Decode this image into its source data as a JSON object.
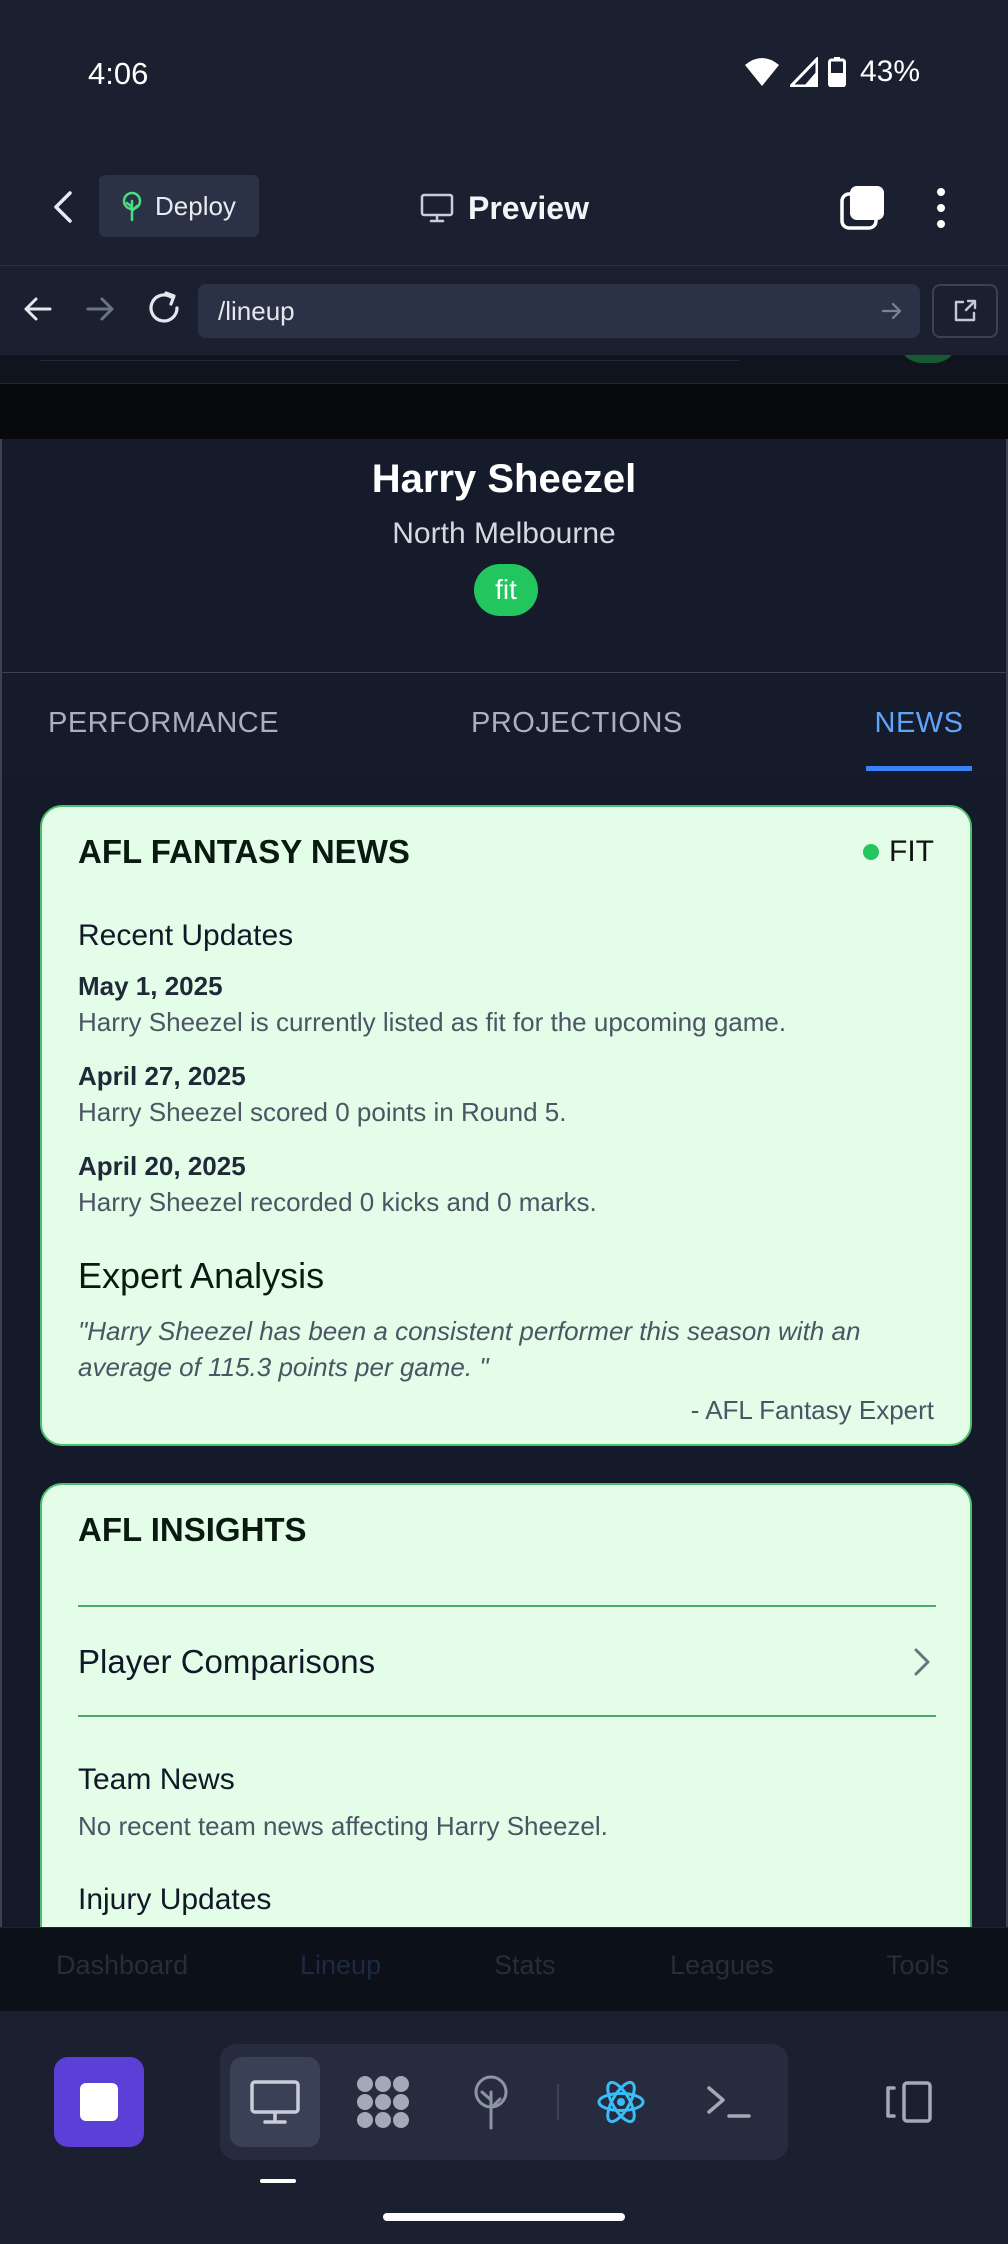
{
  "status_bar": {
    "time": "4:06",
    "battery": "43%"
  },
  "app_bar": {
    "deploy_label": "Deploy",
    "preview_label": "Preview"
  },
  "browser": {
    "url": "/lineup"
  },
  "player": {
    "name": "Harry Sheezel",
    "team": "North Melbourne",
    "status": "fit"
  },
  "tabs": [
    {
      "label": "PERFORMANCE",
      "active": false
    },
    {
      "label": "PROJECTIONS",
      "active": false
    },
    {
      "label": "NEWS",
      "active": true
    }
  ],
  "news_card": {
    "title": "AFL FANTASY NEWS",
    "status_badge": "FIT",
    "recent_heading": "Recent Updates",
    "updates": [
      {
        "date": "May 1, 2025",
        "text": "Harry Sheezel is currently listed as fit for the upcoming game."
      },
      {
        "date": "April 27, 2025",
        "text": "Harry Sheezel scored 0 points in Round 5."
      },
      {
        "date": "April 20, 2025",
        "text": "Harry Sheezel recorded 0 kicks and 0 marks."
      }
    ],
    "expert_heading": "Expert Analysis",
    "expert_quote": "\"Harry Sheezel has been a consistent performer this season with an average of 115.3 points per game. \"",
    "expert_author": "- AFL Fantasy Expert"
  },
  "insights_card": {
    "title": "AFL INSIGHTS",
    "comparisons_label": "Player Comparisons",
    "team_news_heading": "Team News",
    "team_news_text": "No recent team news affecting Harry Sheezel.",
    "injury_heading": "Injury Updates"
  },
  "inner_nav": {
    "items": [
      "Dashboard",
      "Lineup",
      "Stats",
      "Leagues",
      "Tools"
    ]
  },
  "colors": {
    "accent_blue": "#3b82f6",
    "fit_green": "#22c55e",
    "card_bg": "#e3fde8",
    "stop_purple": "#5b3fd6"
  },
  "icons": {
    "deploy": "tree-icon",
    "preview": "monitor-icon",
    "tools": [
      "monitor-icon",
      "grid-icon",
      "antenna-icon",
      "react-icon",
      "terminal-icon"
    ]
  }
}
